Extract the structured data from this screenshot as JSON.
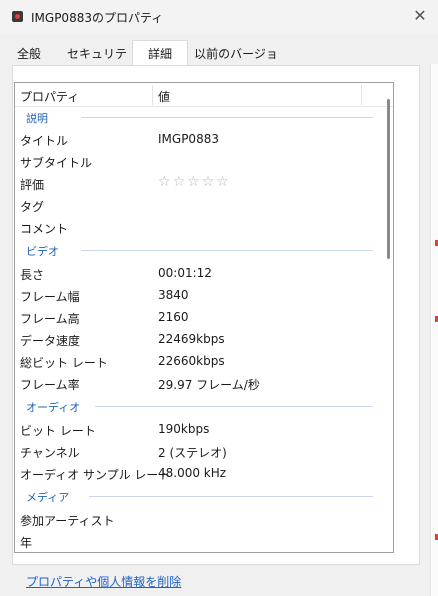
{
  "window": {
    "title": "IMGP0883のプロパティ"
  },
  "tabs": [
    {
      "label": "全般"
    },
    {
      "label": "セキュリティ"
    },
    {
      "label": "詳細"
    },
    {
      "label": "以前のバージョン"
    }
  ],
  "list": {
    "header": {
      "property": "プロパティ",
      "value": "値"
    },
    "groups": [
      {
        "name": "説明",
        "rows": [
          {
            "label": "タイトル",
            "value": "IMGP0883"
          },
          {
            "label": "サブタイトル",
            "value": ""
          },
          {
            "label": "評価",
            "value": "",
            "rating": 0,
            "max": 5
          },
          {
            "label": "タグ",
            "value": ""
          },
          {
            "label": "コメント",
            "value": ""
          }
        ]
      },
      {
        "name": "ビデオ",
        "rows": [
          {
            "label": "長さ",
            "value": "00:01:12"
          },
          {
            "label": "フレーム幅",
            "value": "3840"
          },
          {
            "label": "フレーム高",
            "value": "2160"
          },
          {
            "label": "データ速度",
            "value": "22469kbps"
          },
          {
            "label": "総ビット レート",
            "value": "22660kbps"
          },
          {
            "label": "フレーム率",
            "value": "29.97 フレーム/秒"
          }
        ]
      },
      {
        "name": "オーディオ",
        "rows": [
          {
            "label": "ビット レート",
            "value": "190kbps"
          },
          {
            "label": "チャンネル",
            "value": "2 (ステレオ)"
          },
          {
            "label": "オーディオ サンプル レート",
            "value": "48.000 kHz"
          }
        ]
      },
      {
        "name": "メディア",
        "rows": [
          {
            "label": "参加アーティスト",
            "value": ""
          },
          {
            "label": "年",
            "value": ""
          }
        ]
      }
    ]
  },
  "footer": {
    "remove_link": "プロパティや個人情報を削除"
  },
  "colors": {
    "accent": "#1e64b4",
    "link": "#1f62c4"
  }
}
